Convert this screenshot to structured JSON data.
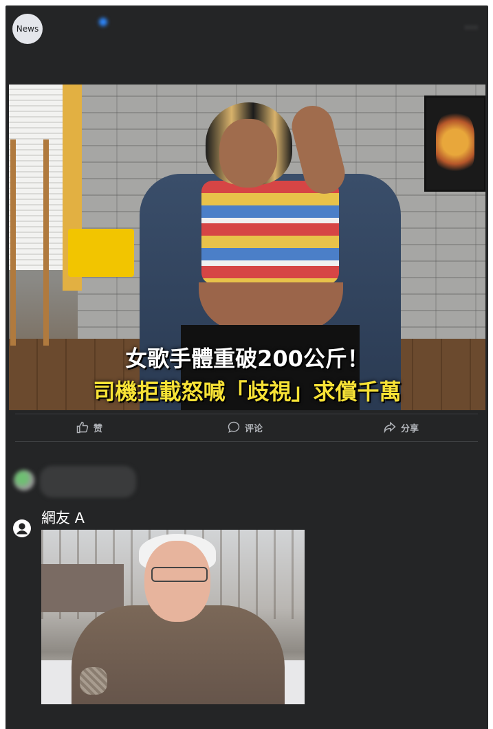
{
  "post": {
    "page_avatar_label": "News",
    "page_name": "",
    "meta": "",
    "more": "···",
    "text_link": "",
    "text": "",
    "text_emoji": "",
    "text_line2": ""
  },
  "image": {
    "caption_line1": "女歌手體重破200公斤！",
    "caption_line2": "司機拒載怒喊「歧視」求償千萬"
  },
  "actions": {
    "like_label": "赞",
    "comment_label": "评论",
    "share_label": "分享"
  },
  "comments": {
    "filter_label": "",
    "first": {
      "name": "",
      "text": ""
    }
  },
  "reply": {
    "user_name": "網友 A"
  },
  "colors": {
    "card_bg": "#242526",
    "caption_yellow": "#f7e236",
    "verified_blue": "#2d88ff"
  },
  "icons": {
    "like": "thumbs-up-icon",
    "comment": "speech-bubble-icon",
    "share": "share-arrow-icon",
    "user": "user-avatar-icon"
  }
}
